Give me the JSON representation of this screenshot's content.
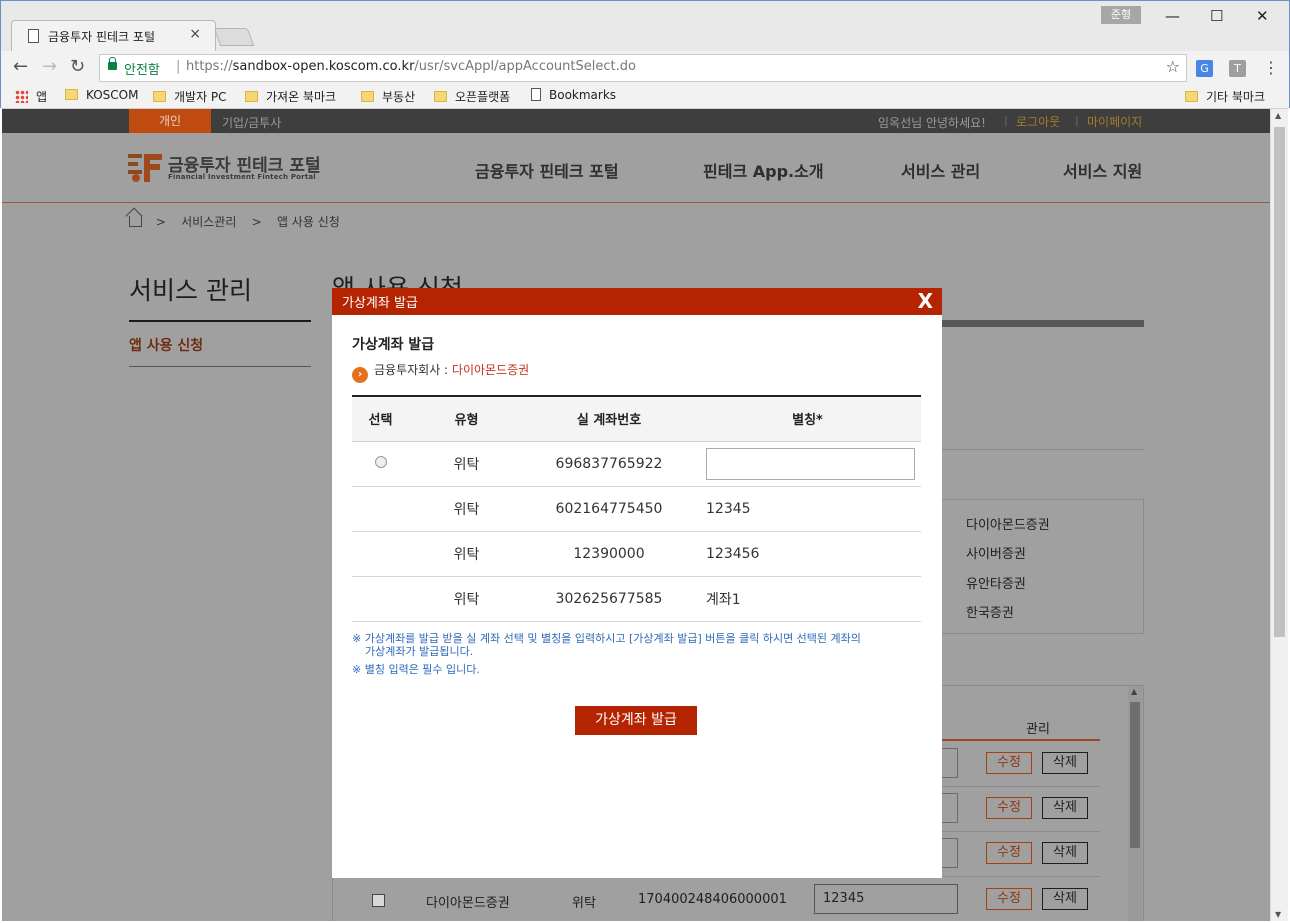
{
  "browser": {
    "tab_title": "금융투자 핀테크 포털",
    "tab_close": "×",
    "profile_name": "준형",
    "window_buttons": [
      "—",
      "☐",
      "✕"
    ],
    "secure_label": "안전함",
    "url_scheme": "https://",
    "url_host": "sandbox-open.koscom.co.kr",
    "url_path": "/usr/svcAppl/appAccountSelect.do",
    "extensions": [
      "G",
      "T"
    ],
    "bookmarks": [
      "앱",
      "KOSCOM",
      "개발자 PC",
      "가져온 북마크",
      "부동산",
      "오픈플랫폼",
      "Bookmarks"
    ],
    "other_bookmarks": "기타 북마크"
  },
  "topbar": {
    "personal": "개인",
    "corporate": "기업/금투사",
    "greeting": "임옥선님 안녕하세요!",
    "logout": "로그아웃",
    "mypage": "마이페이지"
  },
  "header": {
    "logo_title": "금융투자 핀테크 포털",
    "logo_sub": "Financial Investment Fintech Portal",
    "nav": [
      "금융투자 핀테크 포털",
      "핀테크 App.소개",
      "서비스 관리",
      "서비스 지원"
    ]
  },
  "breadcrumb": [
    "서비스관리",
    "앱 사용 신청"
  ],
  "sidebar": {
    "title": "서비스 관리",
    "items": [
      "앱 사용 신청"
    ]
  },
  "main": {
    "title": "앱 사용 신청",
    "companies": [
      "다이아몬드증권",
      "사이버증권",
      "유안타증권",
      "한국증권"
    ],
    "list_head_manage": "관리",
    "edit_label": "수정",
    "delete_label": "삭제",
    "bottom_row": {
      "company": "다이아몬드증권",
      "type": "위탁",
      "account": "170400248406000001",
      "alias": "12345"
    }
  },
  "modal": {
    "header_title": "가상계좌 발급",
    "close": "X",
    "heading": "가상계좌 발급",
    "company_label": "금융투자회사 : ",
    "company_name": "다이아몬드증권",
    "columns": [
      "선택",
      "유형",
      "실 계좌번호",
      "별칭*"
    ],
    "rows": [
      {
        "selectable": true,
        "type": "위탁",
        "account": "696837765922",
        "alias": ""
      },
      {
        "selectable": false,
        "type": "위탁",
        "account": "602164775450",
        "alias": "12345"
      },
      {
        "selectable": false,
        "type": "위탁",
        "account": "12390000",
        "alias": "123456"
      },
      {
        "selectable": false,
        "type": "위탁",
        "account": "302625677585",
        "alias": "계좌1"
      }
    ],
    "note1": "※ 가상계좌를 발급 받을 실 계좌 선택 및 별칭을 입력하시고 [가상계좌 발급] 버튼을 클릭 하시면 선택된 계좌의",
    "note1b": "가상계좌가 발급됩니다.",
    "note2": "※ 별칭 입력은 필수 입니다.",
    "issue_button": "가상계좌 발급"
  },
  "colors": {
    "brand_red": "#b52400",
    "topbar_accent": "#c04b10",
    "note_blue": "#2e6ab8"
  }
}
